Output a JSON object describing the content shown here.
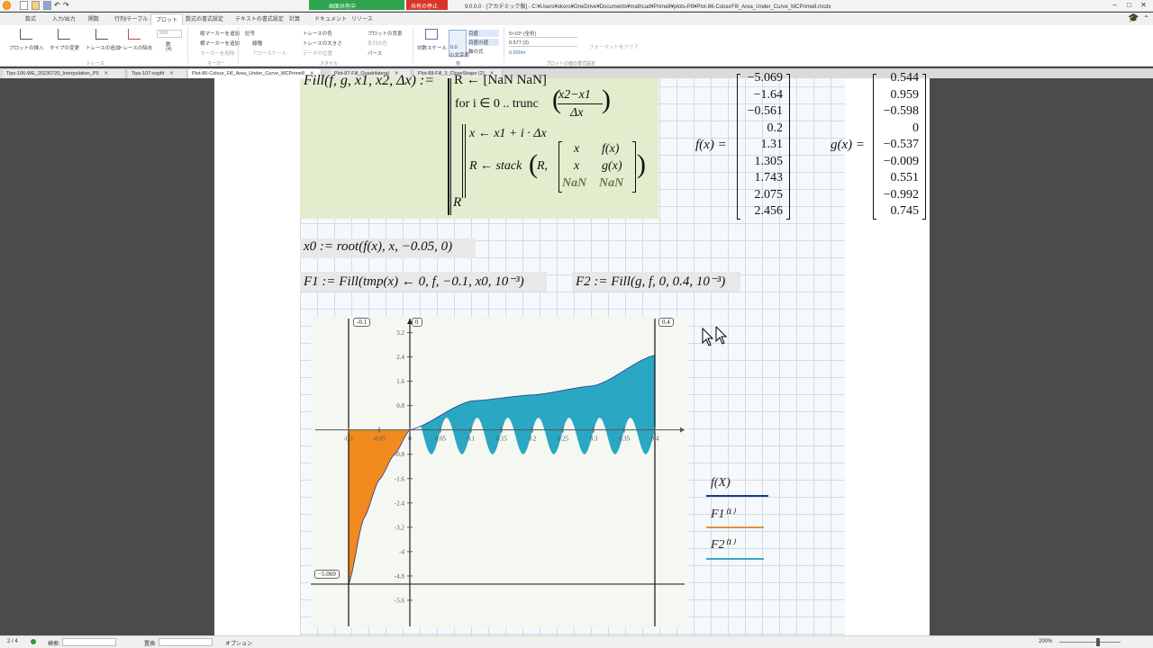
{
  "window": {
    "title": "9.0.0.0 - [アカデミック版] - C:¥Users¥okoro¥OneDrive¥Documents¥mathcad¥Prime8¥plots-P8¥Plot-86-ColourFill_Area_Under_Curve_MCPrime8.mcdx"
  },
  "share": {
    "label": "画面共有中",
    "stop": "共有の停止"
  },
  "ribbon_tabs": [
    "数式",
    "入力/出力",
    "関数",
    "行列/テーブル",
    "プロット",
    "数式の書式設定",
    "テキストの書式設定",
    "計算",
    "ドキュメント",
    "リソース"
  ],
  "ribbon_active": "プロット",
  "ribbon": {
    "insert_plot": "プロットの挿入",
    "change_type": "タイプの変更",
    "add_trace": "トレースの追加",
    "remove_trace": "トレースの除去",
    "trace_group": "トレース",
    "count_value": "500",
    "count_label": "数",
    "count_sub": "(4)",
    "add_vmarker": "縦マーカーを追加",
    "add_hmarker": "横マーカーを追加",
    "delete_marker": "マーカーを削除",
    "marker_group": "マーカー",
    "symbol": "記号",
    "line_style": "線種",
    "trace_color": "トレースの色",
    "trace_size": "トレースの大きさ",
    "arrow": "アロースケール",
    "trace_style": "データの位置",
    "plot_bg": "プロットの背景",
    "chart_bg": "系列の色",
    "surface": "サーフェスの色",
    "perspective": "パース",
    "style_group": "スタイル",
    "log_scale": "対数スケール",
    "num_label": "数字",
    "num_format": "0.0",
    "sci": "小文字表",
    "axis_title": "目盛",
    "axis_items": [
      "目盛",
      "目盛の値",
      "軸の式"
    ],
    "num_value": "5×10³ (全桁)",
    "prec_value": "0.577 (3)",
    "fmt_value": "0.500m",
    "axis_group": "軸",
    "format_group": "プロットの値の書式設定",
    "clear_format": "フォーマットをクリア"
  },
  "doc_tabs": [
    "Tips-106-WE_20230720_Interpolation_P9",
    "Tips-107-expfit",
    "Plot-86-Colour_Fill_Area_Under_Curve_MCPrime8",
    "Plot-87-Fill_Quadrilateral",
    "Plot-88-Fill_3_CloseShape (2)"
  ],
  "doc_tab_active": 2,
  "math": {
    "fill_def": "Fill(f, g, x1, x2, Δx) :=",
    "top_row": "R ← [NaN  NaN]",
    "for_line": "for i ∈ 0 .. trunc",
    "frac_num": "x2−x1",
    "frac_den": "Δx",
    "x_assign": "x ← x1 + i · Δx",
    "stack_line": "R ← stack",
    "stack_R": "R,",
    "stack_m": [
      "x",
      "f(x)",
      "x",
      "g(x)",
      "NaN",
      "NaN"
    ],
    "ret": "R",
    "fx_label": "f(x) =",
    "fx_values": [
      "-5.069",
      "-1.64",
      "-0.561",
      "0.2",
      "1.31",
      "1.305",
      "1.743",
      "2.075",
      "2.456"
    ],
    "gx_label": "g(x) =",
    "gx_values": [
      "0.544",
      "0.959",
      "-0.598",
      "0",
      "-0.537",
      "-0.009",
      "0.551",
      "-0.992",
      "0.745"
    ],
    "x0_def": "x0 := root(f(x), x, −0.05, 0)",
    "f1_def": "F1 := Fill(tmp(x) ← 0, f, −0.1, x0, 10⁻³)",
    "f2_def": "F2 := Fill(g, f, 0, 0.4, 10⁻³)"
  },
  "plot": {
    "marker_left": "-0.1",
    "marker_zero": "0",
    "marker_right": "0.4",
    "marker_min": "−5.069",
    "legend": [
      "f(X)",
      "F1⁽¹⁾",
      "F2⁽¹⁾"
    ],
    "colors": {
      "orange": "#f28a1e",
      "teal": "#2aa7c2",
      "legend_f": "#1f3a93",
      "legend_f1": "#e0933a",
      "legend_f2": "#3aa9c9"
    }
  },
  "chart_data": {
    "type": "area",
    "x_range": [
      -0.1,
      0.4
    ],
    "y_range": [
      -6.4,
      3.6
    ],
    "x_ticks": [
      "-0.1",
      "-0.05",
      "0",
      "0.05",
      "0.1",
      "0.15",
      "0.2",
      "0.25",
      "0.3",
      "0.35",
      "0.4"
    ],
    "y_ticks": [
      "3.2",
      "2.4",
      "1.6",
      "0.8",
      "-0.8",
      "-1.6",
      "-2.4",
      "-3.2",
      "-4",
      "-4.8",
      "-5.6"
    ],
    "series": [
      {
        "name": "f(X)",
        "x": [
          -0.1,
          -0.075,
          -0.05,
          -0.025,
          0,
          0.1,
          0.2,
          0.3,
          0.4
        ],
        "y": [
          -5.069,
          -2.9,
          -1.64,
          -0.8,
          0,
          0.95,
          1.15,
          1.45,
          2.456
        ]
      },
      {
        "name": "F1⁽¹⁾",
        "fill_between": [
          "f",
          "0"
        ],
        "x_range": [
          -0.1,
          0
        ]
      },
      {
        "name": "F2⁽¹⁾",
        "fill_between": [
          "g",
          "f"
        ],
        "x_range": [
          0,
          0.4
        ]
      }
    ]
  },
  "status": {
    "page": "2 / 4",
    "search": "検索:",
    "replace": "置換:",
    "options": "オプション",
    "zoom": "200%"
  }
}
